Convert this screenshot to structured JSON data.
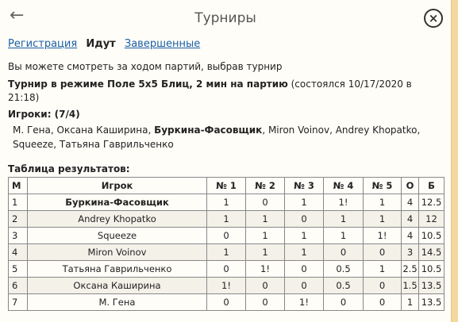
{
  "header": {
    "title": "Турниры"
  },
  "tabs": [
    {
      "label": "Регистрация",
      "active": false
    },
    {
      "label": "Идут",
      "active": true
    },
    {
      "label": "Завершенные",
      "active": false
    }
  ],
  "hint": "Вы можете смотреть за ходом партий, выбрав турнир",
  "tournament": {
    "name": "Турнир в режиме Поле 5x5 Блиц, 2 мин на партию",
    "status": " (состоялся 10/17/2020 в 21:18)",
    "players_label": "Игроки: (7/4)",
    "players_before": "М. Гена, Оксана Каширина, ",
    "players_bold": "Буркина-Фасовщик",
    "players_after": ", Miron Voinov, Andrey Khopatko, Squeeze, Татьяна Гаврильченко"
  },
  "results": {
    "title": "Таблица результатов:",
    "columns": [
      "М",
      "Игрок",
      "№ 1",
      "№ 2",
      "№ 3",
      "№ 4",
      "№ 5",
      "О",
      "Б"
    ],
    "rows": [
      [
        "1",
        "Буркина-Фасовщик",
        "1",
        "0",
        "1",
        "1!",
        "1",
        "4",
        "12.5"
      ],
      [
        "2",
        "Andrey Khopatko",
        "1",
        "1",
        "0",
        "1",
        "1",
        "4",
        "12"
      ],
      [
        "3",
        "Squeeze",
        "0",
        "1",
        "1",
        "1",
        "1!",
        "4",
        "10.5"
      ],
      [
        "4",
        "Miron Voinov",
        "1",
        "1",
        "1",
        "0",
        "0",
        "3",
        "14.5"
      ],
      [
        "5",
        "Татьяна Гаврильченко",
        "0",
        "1!",
        "0",
        "0.5",
        "1",
        "2.5",
        "10.5"
      ],
      [
        "6",
        "Оксана Каширина",
        "1!",
        "0",
        "0",
        "0.5",
        "0",
        "1.5",
        "13.5"
      ],
      [
        "7",
        "М. Гена",
        "0",
        "0",
        "1!",
        "0",
        "0",
        "1",
        "13.5"
      ]
    ]
  }
}
